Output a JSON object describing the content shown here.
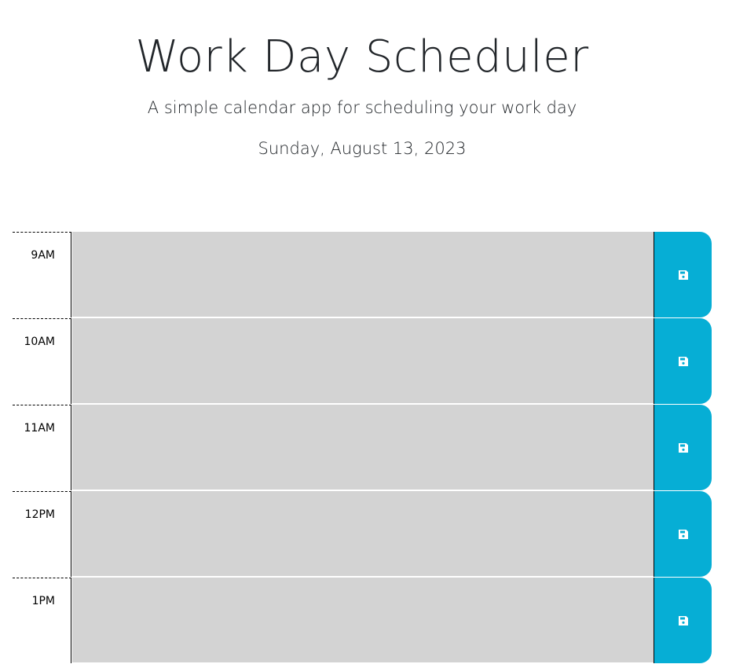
{
  "header": {
    "title": "Work Day Scheduler",
    "subtitle": "A simple calendar app for scheduling your work day",
    "current_date": "Sunday, August 13, 2023"
  },
  "colors": {
    "description_bg": "#d3d3d3",
    "save_button_bg": "#06aed5"
  },
  "schedule": {
    "blocks": [
      {
        "hour": "9AM",
        "description": "",
        "save_icon": "floppy-disk-icon"
      },
      {
        "hour": "10AM",
        "description": "",
        "save_icon": "floppy-disk-icon"
      },
      {
        "hour": "11AM",
        "description": "",
        "save_icon": "floppy-disk-icon"
      },
      {
        "hour": "12PM",
        "description": "",
        "save_icon": "floppy-disk-icon"
      },
      {
        "hour": "1PM",
        "description": "",
        "save_icon": "floppy-disk-icon"
      }
    ]
  }
}
